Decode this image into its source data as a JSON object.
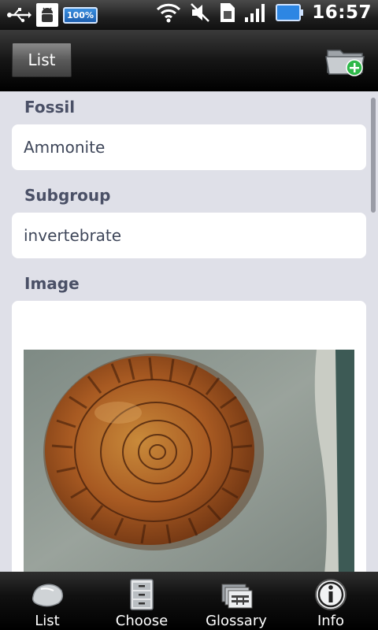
{
  "status_bar": {
    "battery_badge": "100%",
    "time": "16:57"
  },
  "action_bar": {
    "list_button_label": "List"
  },
  "detail": {
    "fossil_label": "Fossil",
    "fossil_value": "Ammonite",
    "subgroup_label": "Subgroup",
    "subgroup_value": "invertebrate",
    "image_label": "Image"
  },
  "tabs": [
    {
      "label": "List",
      "icon": "rock-icon"
    },
    {
      "label": "Choose",
      "icon": "cabinet-icon"
    },
    {
      "label": "Glossary",
      "icon": "cards-icon"
    },
    {
      "label": "Info",
      "icon": "info-icon"
    }
  ],
  "colors": {
    "background": "#dfe0e8",
    "label": "#4a5066",
    "value_text": "#3e4659",
    "add_badge": "#2fb84a"
  }
}
